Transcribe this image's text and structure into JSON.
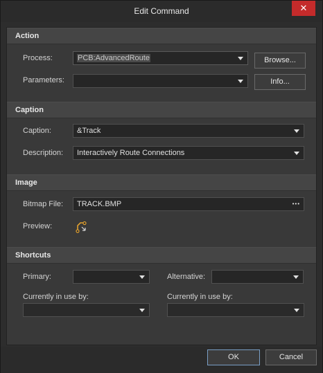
{
  "window": {
    "title": "Edit Command",
    "close_glyph": "✕"
  },
  "action": {
    "header": "Action",
    "process_label": "Process:",
    "process_value": "PCB:AdvancedRoute",
    "parameters_label": "Parameters:",
    "parameters_value": "",
    "browse_label": "Browse...",
    "info_label": "Info..."
  },
  "caption": {
    "header": "Caption",
    "caption_label": "Caption:",
    "caption_value": "&Track",
    "description_label": "Description:",
    "description_value": "Interactively Route Connections"
  },
  "image": {
    "header": "Image",
    "bitmap_label": "Bitmap File:",
    "bitmap_value": "TRACK.BMP",
    "bitmap_dots": "•••",
    "preview_label": "Preview:",
    "preview_icon": "interactive-route-icon"
  },
  "shortcuts": {
    "header": "Shortcuts",
    "primary_label": "Primary:",
    "alternative_label": "Alternative:",
    "in_use_primary_label": "Currently in use by:",
    "in_use_alternative_label": "Currently in use by:"
  },
  "footer": {
    "ok_label": "OK",
    "cancel_label": "Cancel"
  },
  "colors": {
    "accent": "#7a9fc6",
    "close": "#c42b2b",
    "route_icon": "#e0a030"
  }
}
